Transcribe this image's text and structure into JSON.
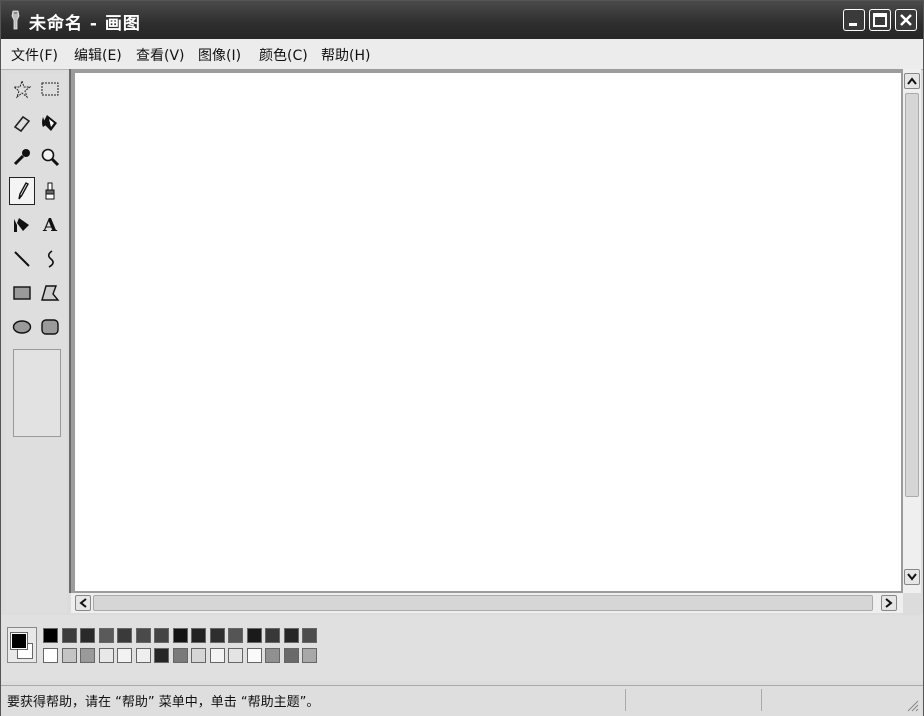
{
  "window": {
    "title": "未命名 - 画图",
    "controls": [
      "minimize-icon",
      "maximize-icon",
      "close-icon"
    ]
  },
  "menu": [
    {
      "label": "文件(F)"
    },
    {
      "label": "编辑(E)"
    },
    {
      "label": "查看(V)"
    },
    {
      "label": "图像(I)"
    },
    {
      "label": "颜色(C)"
    },
    {
      "label": "帮助(H)"
    }
  ],
  "toolbox": {
    "tools": [
      {
        "name": "free-form-select",
        "icon": "star-select-icon"
      },
      {
        "name": "rect-select",
        "icon": "rect-select-icon"
      },
      {
        "name": "eraser",
        "icon": "eraser-icon"
      },
      {
        "name": "fill",
        "icon": "fill-bucket-icon"
      },
      {
        "name": "pick-color",
        "icon": "eyedropper-icon"
      },
      {
        "name": "magnifier",
        "icon": "magnifier-icon"
      },
      {
        "name": "pencil",
        "icon": "pencil-icon",
        "active": true
      },
      {
        "name": "brush",
        "icon": "brush-icon"
      },
      {
        "name": "airbrush",
        "icon": "airbrush-icon"
      },
      {
        "name": "text",
        "icon": "text-icon",
        "glyph": "A"
      },
      {
        "name": "line",
        "icon": "line-icon"
      },
      {
        "name": "curve",
        "icon": "curve-icon"
      },
      {
        "name": "rectangle",
        "icon": "rectangle-icon"
      },
      {
        "name": "polygon",
        "icon": "polygon-icon"
      },
      {
        "name": "ellipse",
        "icon": "ellipse-icon"
      },
      {
        "name": "rounded-rectangle",
        "icon": "rounded-rect-icon"
      }
    ]
  },
  "palette": {
    "foreground": "#000000",
    "background": "#ffffff",
    "row1": [
      "#000000",
      "#3c3c3c",
      "#2a2a2a",
      "#5a5a5a",
      "#3a3a3a",
      "#4a4a4a",
      "#444444",
      "#141414",
      "#222222",
      "#2e2e2e",
      "#555555",
      "#1a1a1a",
      "#383838",
      "#262626",
      "#4c4c4c"
    ],
    "row2": [
      "#ffffff",
      "#c4c4c4",
      "#9a9a9a",
      "#e8e8e8",
      "#f2f2f2",
      "#eeeeee",
      "#262626",
      "#7a7a7a",
      "#d6d6d6",
      "#f4f4f4",
      "#e4e4e4",
      "#fafafa",
      "#909090",
      "#6a6a6a",
      "#a8a8a8"
    ]
  },
  "status": {
    "text": "要获得帮助，请在 “帮助” 菜单中，单击 “帮助主题”。"
  }
}
